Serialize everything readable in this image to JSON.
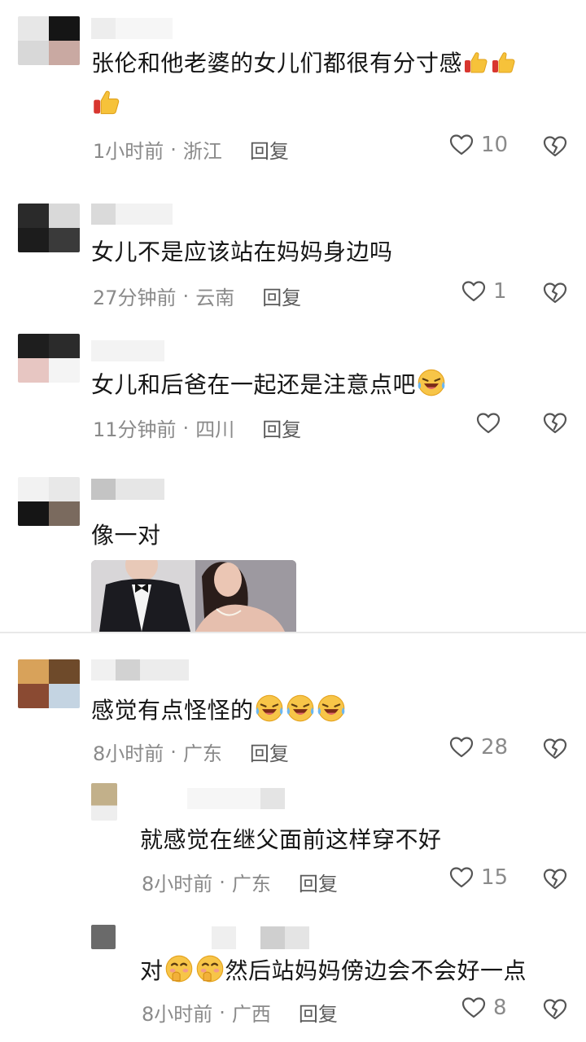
{
  "comments": [
    {
      "text_line1": "张伦和他老婆的女儿们都很有分寸感",
      "text_line2": "",
      "time": "1小时前",
      "location": "浙江",
      "reply": "回复",
      "likes": "10",
      "emoji_name": "thumbs-up-emoji"
    },
    {
      "text": "女儿不是应该站在妈妈身边吗",
      "time": "27分钟前",
      "location": "云南",
      "reply": "回复",
      "likes": "1"
    },
    {
      "text": "女儿和后爸在一起还是注意点吧",
      "time": "11分钟前",
      "location": "四川",
      "reply": "回复",
      "likes": "",
      "emoji_name": "laughing-crying-emoji"
    },
    {
      "text": "像一对"
    },
    {
      "text": "感觉有点怪怪的",
      "time": "8小时前",
      "location": "广东",
      "reply": "回复",
      "likes": "28",
      "emoji_name": "laughing-crying-emoji"
    },
    {
      "text": "就感觉在继父面前这样穿不好",
      "time": "8小时前",
      "location": "广东",
      "reply": "回复",
      "likes": "15"
    },
    {
      "text_pre": "对",
      "text_post": "然后站妈妈傍边会不会好一点",
      "time": "8小时前",
      "location": "广西",
      "reply": "回复",
      "likes": "8",
      "emoji_name": "giggle-emoji"
    }
  ],
  "separator": "·",
  "colors": {
    "text": "#161616",
    "meta": "#8a8a8a",
    "reply": "#5a5a5a",
    "background": "#ffffff"
  },
  "icons": {
    "like": "heart-outline-icon",
    "dislike": "broken-heart-icon"
  }
}
